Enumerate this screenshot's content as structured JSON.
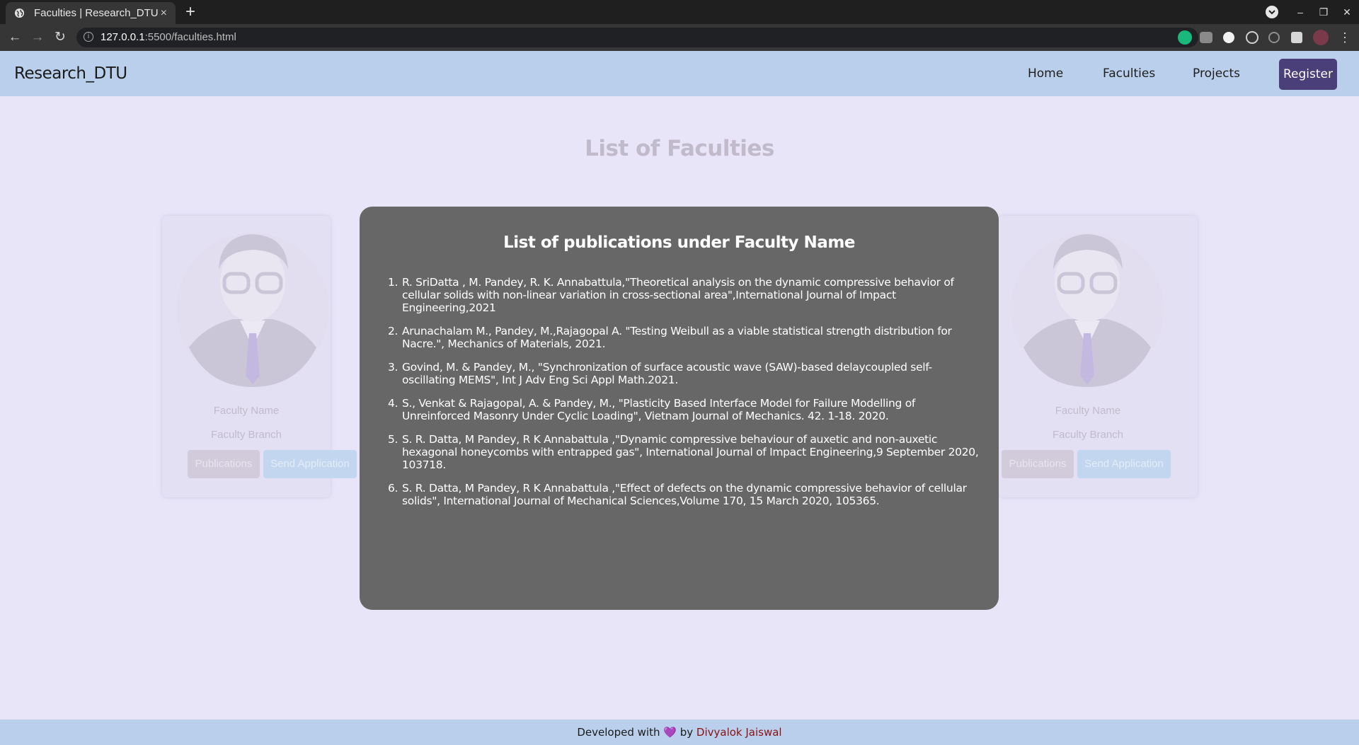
{
  "browser": {
    "tab_title": "Faculties | Research_DTU",
    "tab_close": "×",
    "new_tab": "+",
    "url_host": "127.0.0.1",
    "url_path": ":5500/faculties.html",
    "win_minimize": "–",
    "win_restore": "❐",
    "win_close": "✕",
    "icons": [
      "globe-icon",
      "back-icon",
      "forward-icon",
      "reload-icon",
      "info-icon",
      "star-icon",
      "grammarly-icon",
      "camera-icon",
      "extension-icon",
      "settings-icon",
      "alarm-icon",
      "puzzle-icon",
      "profile-avatar",
      "menu-icon"
    ]
  },
  "navbar": {
    "brand": "Research_DTU",
    "links": [
      "Home",
      "Faculties",
      "Projects"
    ],
    "register": "Register"
  },
  "page": {
    "title": "List of Faculties"
  },
  "cards": [
    {
      "name": "Faculty Name",
      "branch": "Faculty Branch",
      "publications": "Publications",
      "send": "Send Application"
    },
    {
      "name": "Faculty Name",
      "branch": "Faculty Branch",
      "publications": "Publications",
      "send": "Send Application"
    }
  ],
  "modal": {
    "title": "List of publications under Faculty Name",
    "publications": [
      "R. SriDatta , M. Pandey, R. K. Annabattula,\"Theoretical analysis on the dynamic compressive behavior of cellular solids with non-linear variation in cross-sectional area\",International Journal of Impact Engineering,2021",
      "Arunachalam M., Pandey, M.,Rajagopal A. \"Testing Weibull as a viable statistical strength distribution for Nacre.\", Mechanics of Materials, 2021.",
      "Govind, M. & Pandey, M., \"Synchronization of surface acoustic wave (SAW)-based delaycoupled self-oscillating MEMS\", Int J Adv Eng Sci Appl Math.2021.",
      "S., Venkat & Rajagopal, A. & Pandey, M., \"Plasticity Based Interface Model for Failure Modelling of Unreinforced Masonry Under Cyclic Loading\", Vietnam Journal of Mechanics. 42. 1-18. 2020.",
      "S. R. Datta, M Pandey, R K Annabattula ,\"Dynamic compressive behaviour of auxetic and non-auxetic hexagonal honeycombs with entrapped gas\", International Journal of Impact Engineering,9 September 2020, 103718.",
      "S. R. Datta, M Pandey, R K Annabattula ,\"Effect of defects on the dynamic compressive behavior of cellular solids\", International Journal of Mechanical Sciences,Volume 170, 15 March 2020, 105365."
    ]
  },
  "footer": {
    "prefix": "Developed with",
    "heart": "💜",
    "by": "by",
    "author": "Divyalok Jaiswal"
  }
}
